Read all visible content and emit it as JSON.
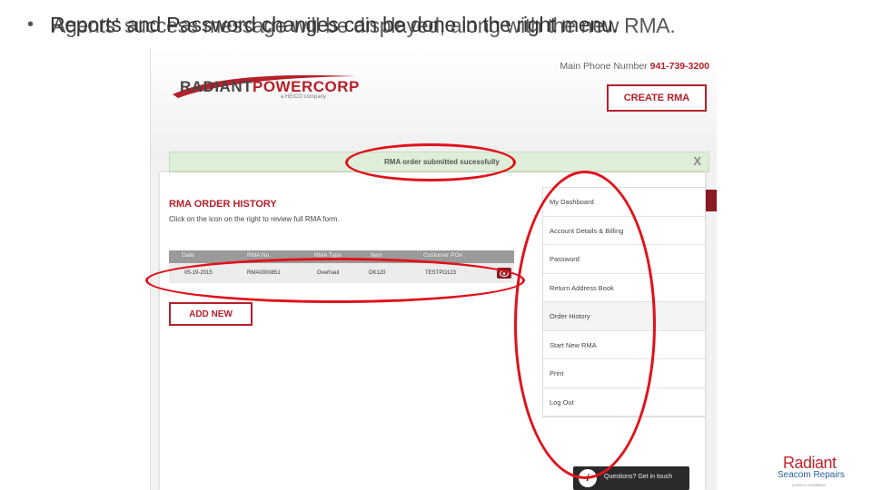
{
  "slide": {
    "bullet": "•",
    "line_a": "Reports and Password changes can be done in the right menu.",
    "line_b": "Agents' success message will be displayed, along with the new RMA."
  },
  "header": {
    "logo_dark": "RADIANT",
    "logo_red": "POWERCORP",
    "logo_sub": "a HEICO company",
    "phone_label": "Main Phone Number",
    "phone_number": "941-739-3200",
    "create_button": "CREATE RMA"
  },
  "banner": {
    "message": "RMA order submitted sucessfully",
    "close": "X"
  },
  "history": {
    "title": "RMA ORDER HISTORY",
    "subtitle": "Click on the icon on the right to review full RMA form.",
    "columns": [
      "Date",
      "RMA No.",
      "RMA Type",
      "Item",
      "Customer PO#"
    ],
    "rows": [
      [
        "05-19-2015",
        "RMA0000851",
        "Overhaul",
        "DK120",
        "TESTPO123"
      ]
    ],
    "add_button": "ADD NEW"
  },
  "menu": {
    "items": [
      {
        "label": "My Dashboard"
      },
      {
        "label": "Account Details & Billing"
      },
      {
        "label": "Password"
      },
      {
        "label": "Return Address Book"
      },
      {
        "label": "Order History"
      },
      {
        "label": "Start New RMA"
      },
      {
        "label": "Print"
      },
      {
        "label": "Log Out"
      }
    ],
    "active_index": 4
  },
  "help": {
    "icon_letter": "i",
    "text": "Questions? Get in touch"
  },
  "brand": {
    "line1": "Radiant",
    "line2": "Seacom Repairs",
    "line3": "A HEICO COMPANY"
  },
  "colors": {
    "accent_red": "#b5202a",
    "annotation_red": "#e0121b",
    "success_green": "#dfeed9"
  }
}
